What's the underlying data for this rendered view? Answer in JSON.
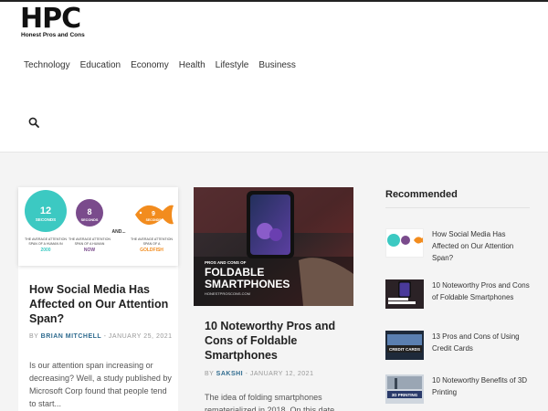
{
  "logo": {
    "mark": "HPC",
    "tagline": "Honest Pros and Cons"
  },
  "nav": [
    "Technology",
    "Education",
    "Economy",
    "Health",
    "Lifestyle",
    "Business"
  ],
  "search": {
    "icon": "search-icon"
  },
  "posts": [
    {
      "title": "How Social Media Has Affected on Our Attention Span?",
      "by": "BY",
      "author": "BRIAN MITCHELL",
      "sep": " - ",
      "date": "JANUARY 25, 2021",
      "excerpt": "Is our attention span increasing or decreasing? Well, a study published by Microsoft Corp found that people tend to start...",
      "infographic": {
        "a_num": "12",
        "a_unit": "SECONDS",
        "a_cap1": "THE AVERAGE ATTENTION",
        "a_cap2": "SPAN OF A HUMAN IN",
        "a_year": "2000",
        "b_num": "8",
        "b_unit": "SECONDS",
        "b_cap1": "THE AVERAGE ATTENTION",
        "b_cap2": "SPAN OF A HUMAN",
        "b_year": "NOW",
        "and": "AND...",
        "c_num": "9",
        "c_unit": "SECONDS",
        "c_cap1": "THE AVERAGE ATTENTION",
        "c_cap2": "SPAN OF A",
        "c_year": "GOLDFISH"
      }
    },
    {
      "title": "10 Noteworthy Pros and Cons of Foldable Smartphones",
      "by": "BY",
      "author": "SAKSHI",
      "sep": " - ",
      "date": "JANUARY 12, 2021",
      "excerpt": "The idea of folding smartphones rematerialized in 2018. On this date,",
      "banner": {
        "small": "PROS AND CONS OF",
        "big1": "FOLDABLE",
        "big2": "SMARTPHONES",
        "site": "HONESTPROSCONS.COM"
      }
    }
  ],
  "sidebar": {
    "title": "Recommended",
    "items": [
      {
        "label": "How Social Media Has Affected on Our Attention Span?"
      },
      {
        "label": "10 Noteworthy Pros and Cons of Foldable Smartphones"
      },
      {
        "label": "13 Pros and Cons of Using Credit Cards",
        "thumb_text": "CREDIT CARDS"
      },
      {
        "label": "10 Noteworthy Benefits of 3D Printing",
        "thumb_text": "3D PRINTING"
      }
    ]
  },
  "colors": {
    "accent": "#2f6b8f",
    "teal": "#3cc9c2",
    "purple": "#7a4b8c",
    "orange": "#f28c1e"
  }
}
